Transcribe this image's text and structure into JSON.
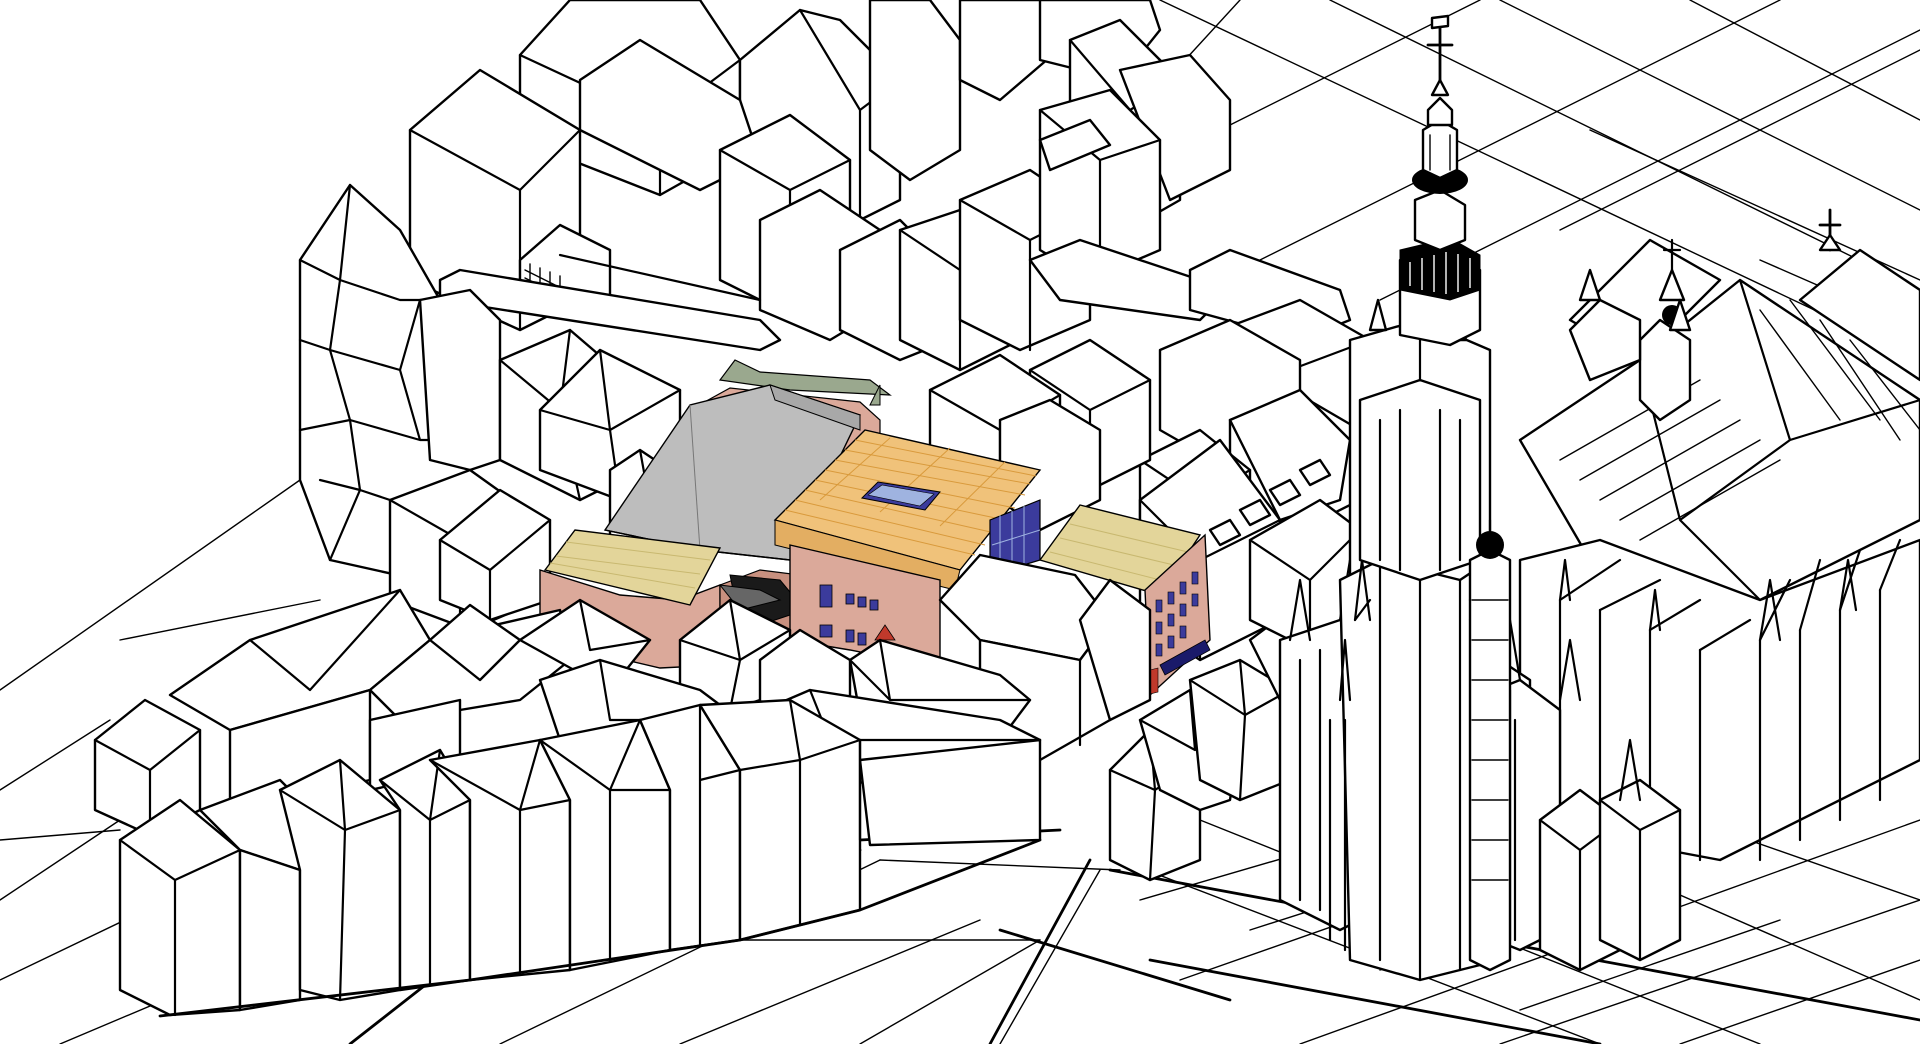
{
  "colors": {
    "background": "#ffffff",
    "outline": "#000000",
    "highlight_roof_grey": "#bdbdbd",
    "highlight_roof_grey_shade": "#a8a8a8",
    "highlight_roof_timber": "#f0c27a",
    "highlight_roof_timber_lines": "#d99a3c",
    "highlight_roof_sand": "#e3d59a",
    "highlight_wall_brick": "#dba99a",
    "highlight_wall_brick_dark": "#c8907f",
    "highlight_glazing": "#3b3b9c",
    "highlight_glazing_light": "#9fb3e0",
    "back_strip_green": "#9aa88e"
  },
  "icons": {
    "church_spire": "cross-spire-icon",
    "church_cross": "cross-icon"
  }
}
